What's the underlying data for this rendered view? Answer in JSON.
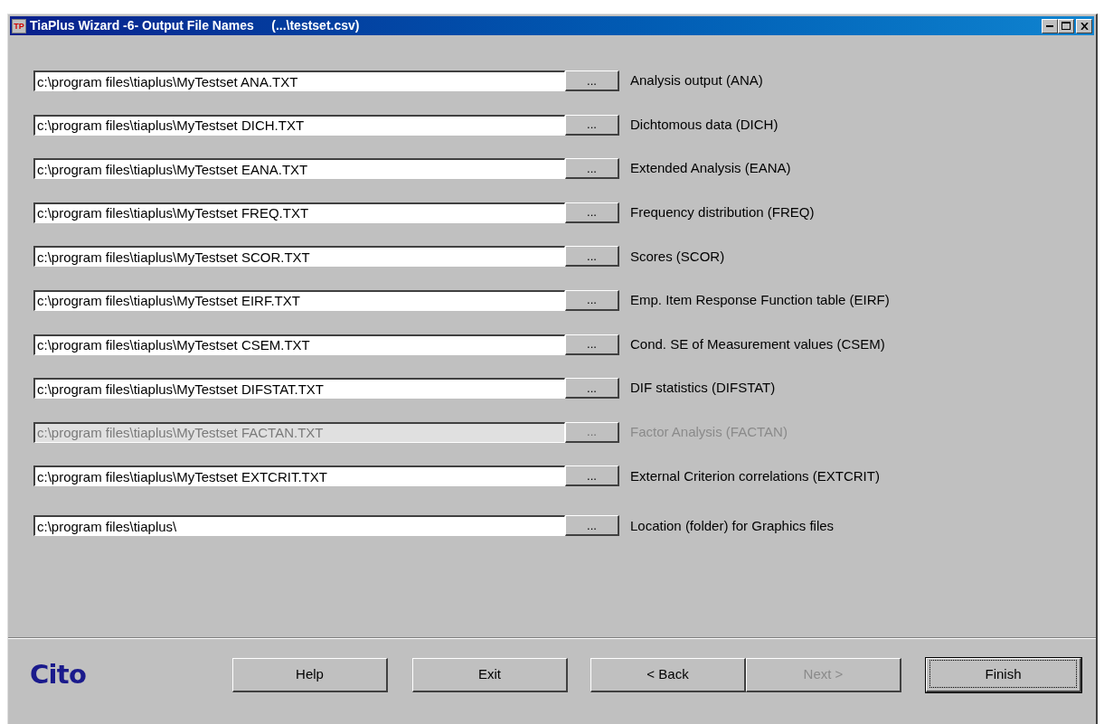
{
  "window": {
    "title": "TiaPlus Wizard -6- Output File Names     (...\\testset.csv)",
    "app_icon": "TP"
  },
  "rows": [
    {
      "value": "c:\\program files\\tiaplus\\MyTestset ANA.TXT",
      "browse": "...",
      "label": "Analysis output (ANA)",
      "disabled": false
    },
    {
      "value": "c:\\program files\\tiaplus\\MyTestset DICH.TXT",
      "browse": "...",
      "label": "Dichtomous data (DICH)",
      "disabled": false
    },
    {
      "value": "c:\\program files\\tiaplus\\MyTestset EANA.TXT",
      "browse": "...",
      "label": "Extended Analysis (EANA)",
      "disabled": false
    },
    {
      "value": "c:\\program files\\tiaplus\\MyTestset FREQ.TXT",
      "browse": "...",
      "label": "Frequency distribution (FREQ)",
      "disabled": false
    },
    {
      "value": "c:\\program files\\tiaplus\\MyTestset SCOR.TXT",
      "browse": "...",
      "label": "Scores (SCOR)",
      "disabled": false
    },
    {
      "value": "c:\\program files\\tiaplus\\MyTestset EIRF.TXT",
      "browse": "...",
      "label": "Emp. Item Response Function table (EIRF)",
      "disabled": false
    },
    {
      "value": "c:\\program files\\tiaplus\\MyTestset CSEM.TXT",
      "browse": "...",
      "label": "Cond. SE of Measurement values (CSEM)",
      "disabled": false
    },
    {
      "value": "c:\\program files\\tiaplus\\MyTestset DIFSTAT.TXT",
      "browse": "...",
      "label": "DIF statistics (DIFSTAT)",
      "disabled": false
    },
    {
      "value": "c:\\program files\\tiaplus\\MyTestset FACTAN.TXT",
      "browse": "...",
      "label": "Factor Analysis (FACTAN)",
      "disabled": true
    },
    {
      "value": "c:\\program files\\tiaplus\\MyTestset EXTCRIT.TXT",
      "browse": "...",
      "label": "External Criterion correlations (EXTCRIT)",
      "disabled": false
    }
  ],
  "graphics_row": {
    "value": "c:\\program files\\tiaplus\\",
    "browse": "...",
    "label": "Location (folder) for Graphics files",
    "disabled": false
  },
  "logo": "Cito",
  "buttons": [
    {
      "label": "Help",
      "disabled": false,
      "default": false
    },
    {
      "label": "Exit",
      "disabled": false,
      "default": false
    },
    {
      "label": "< Back",
      "disabled": false,
      "default": false
    },
    {
      "label": "Next >",
      "disabled": true,
      "default": false
    },
    {
      "label": "Finish",
      "disabled": false,
      "default": true
    }
  ]
}
